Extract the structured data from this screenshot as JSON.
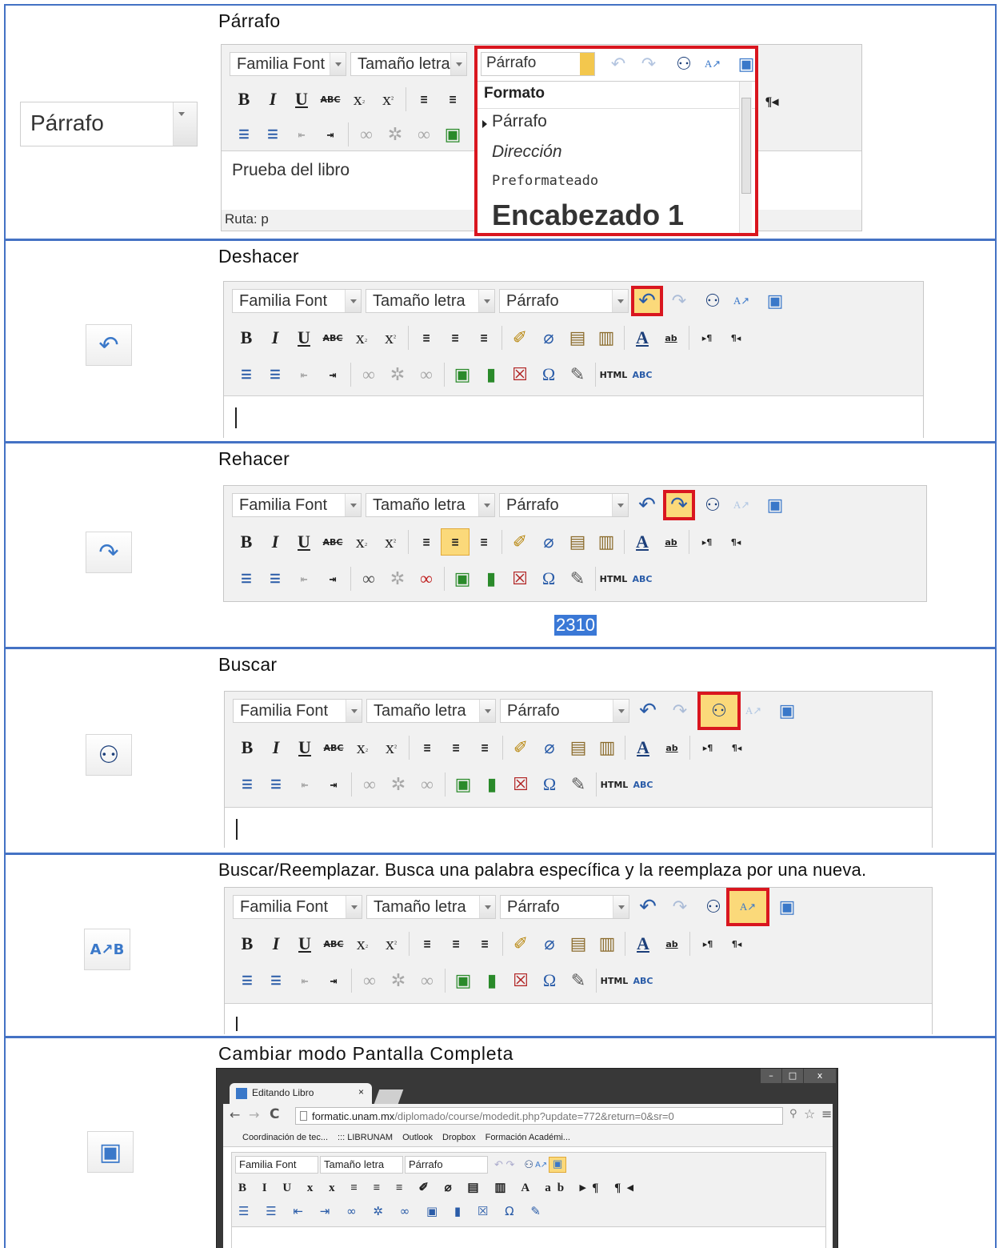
{
  "editor": {
    "font_family": "Familia Font",
    "font_size": "Tamaño letra",
    "format": "Párrafo",
    "html_label": "HTML",
    "abc_label": "ABC",
    "abc_strike": "ABC",
    "ab_label": "ab"
  },
  "rows": {
    "parrafo": {
      "title": "Párrafo",
      "left_select": "Párrafo",
      "text": "Prueba del libro",
      "path": "Ruta: p",
      "dropdown": {
        "title": "Formato",
        "items": [
          "Párrafo",
          "Dirección",
          "Preformateado",
          "Encabezado 1"
        ]
      }
    },
    "deshacer": {
      "title": "Deshacer"
    },
    "rehacer": {
      "title": "Rehacer",
      "selected_text": "2310"
    },
    "buscar": {
      "title": "Buscar"
    },
    "reemplazar": {
      "title": "Buscar/Reemplazar. Busca una palabra específica y la reemplaza por una nueva."
    },
    "pantalla": {
      "title": "Cambiar modo Pantalla Completa",
      "browser": {
        "tab_title": "Editando Libro",
        "url_host": "formatic.unam.mx",
        "url_path": "/diplomado/course/modedit.php?update=772&return=0&sr=0",
        "bookmarks": [
          "Coordinación de tec...",
          "::: LIBRUNAM",
          "Outlook",
          "Dropbox",
          "Formación Académi..."
        ]
      }
    }
  },
  "colors": {
    "border_blue": "#4472c4",
    "highlight_red": "#d9161f",
    "icon_blue": "#3a78c9",
    "selection_blue": "#3a78d6"
  }
}
